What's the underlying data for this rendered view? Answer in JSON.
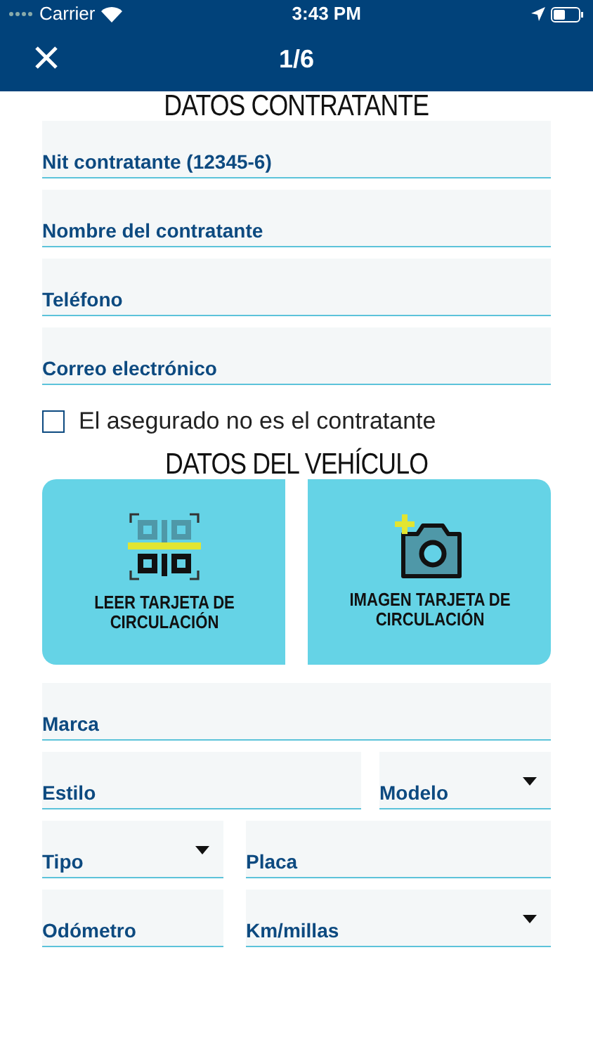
{
  "status_bar": {
    "carrier": "Carrier",
    "time": "3:43 PM"
  },
  "header": {
    "title": "1/6"
  },
  "sections": [
    {
      "title": "DATOS CONTRATANTE",
      "rows": [
        [
          {
            "kind": "text",
            "placeholder": "Nit contratante (12345-6)"
          }
        ],
        [
          {
            "kind": "text",
            "placeholder": "Nombre del contratante"
          }
        ],
        [
          {
            "kind": "text",
            "placeholder": "Teléfono"
          }
        ],
        [
          {
            "kind": "text",
            "placeholder": "Correo electrónico"
          }
        ]
      ],
      "checkbox": {
        "label": "El asegurado no es el contratante",
        "checked": false
      }
    },
    {
      "title": "DATOS DEL VEHÍCULO",
      "actions": [
        {
          "kind": "scan",
          "label": "LEER TARJETA DE CIRCULACIÓN"
        },
        {
          "kind": "camera",
          "label": "IMAGEN TARJETA DE CIRCULACIÓN"
        }
      ],
      "rows": [
        [
          {
            "kind": "text",
            "placeholder": "Marca"
          }
        ],
        [
          {
            "kind": "text",
            "placeholder": "Estilo"
          },
          {
            "kind": "select",
            "placeholder": "Modelo"
          }
        ],
        [
          {
            "kind": "select",
            "placeholder": "Tipo"
          },
          {
            "kind": "text",
            "placeholder": "Placa"
          }
        ],
        [
          {
            "kind": "text",
            "placeholder": "Odómetro"
          },
          {
            "kind": "select",
            "placeholder": "Km/millas"
          }
        ]
      ]
    }
  ]
}
